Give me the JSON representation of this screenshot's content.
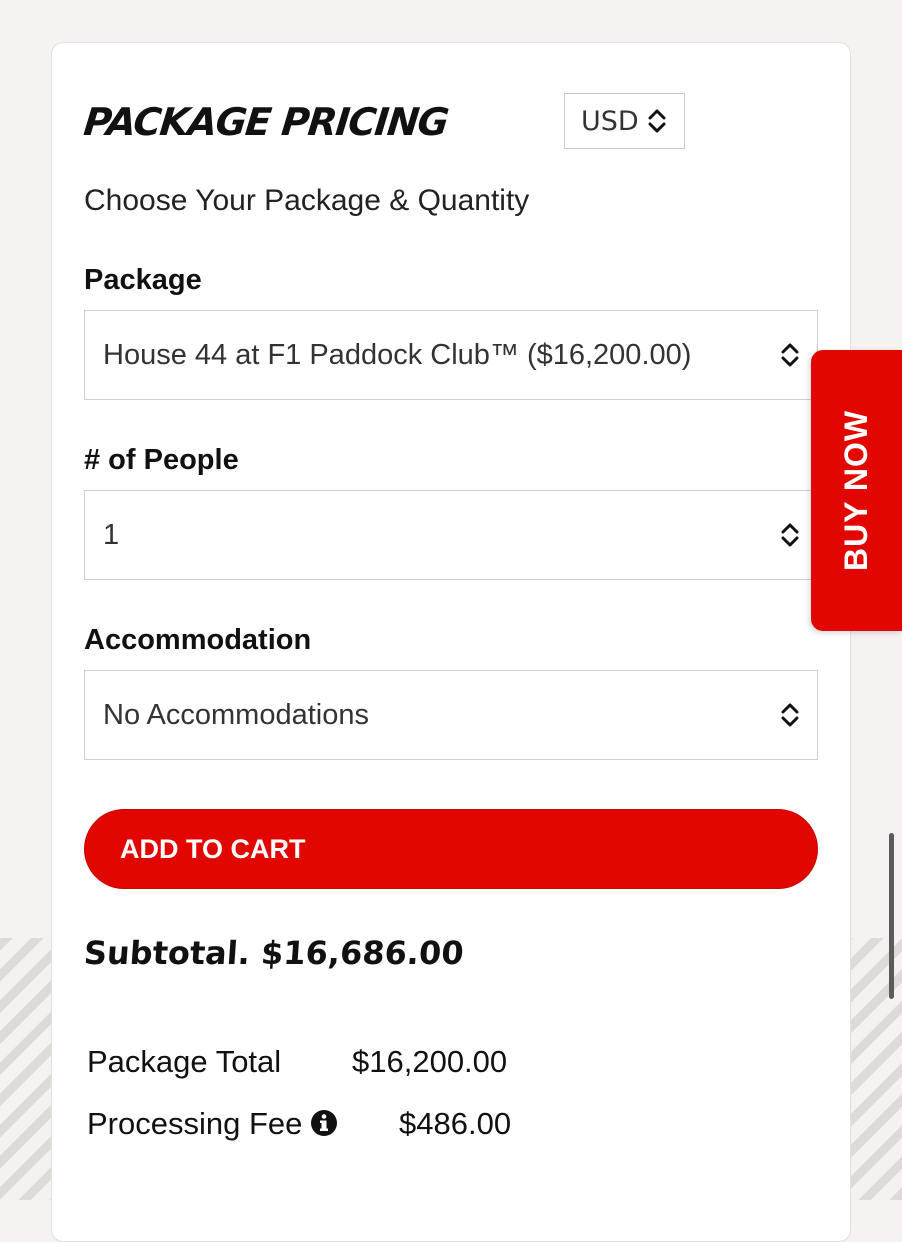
{
  "header": {
    "title": "PACKAGE PRICING",
    "currency": "USD",
    "subtitle": "Choose Your Package & Quantity"
  },
  "form": {
    "package_label": "Package",
    "package_value": "House 44 at F1 Paddock Club™ ($16,200.00)",
    "people_label": "# of People",
    "people_value": "1",
    "accommodation_label": "Accommodation",
    "accommodation_value": "No Accommodations",
    "add_to_cart": "ADD TO CART"
  },
  "buy_now": "BUY NOW",
  "summary": {
    "subtotal": "Subtotal. $16,686.00",
    "package_total_label": "Package Total",
    "package_total_value": "$16,200.00",
    "processing_fee_label": "Processing Fee",
    "processing_fee_value": "$486.00"
  },
  "colors": {
    "accent": "#e10600",
    "background": "#f6f2f1"
  },
  "icons": {
    "select_chevron": "chevron-up-down-icon",
    "info": "info-icon"
  }
}
